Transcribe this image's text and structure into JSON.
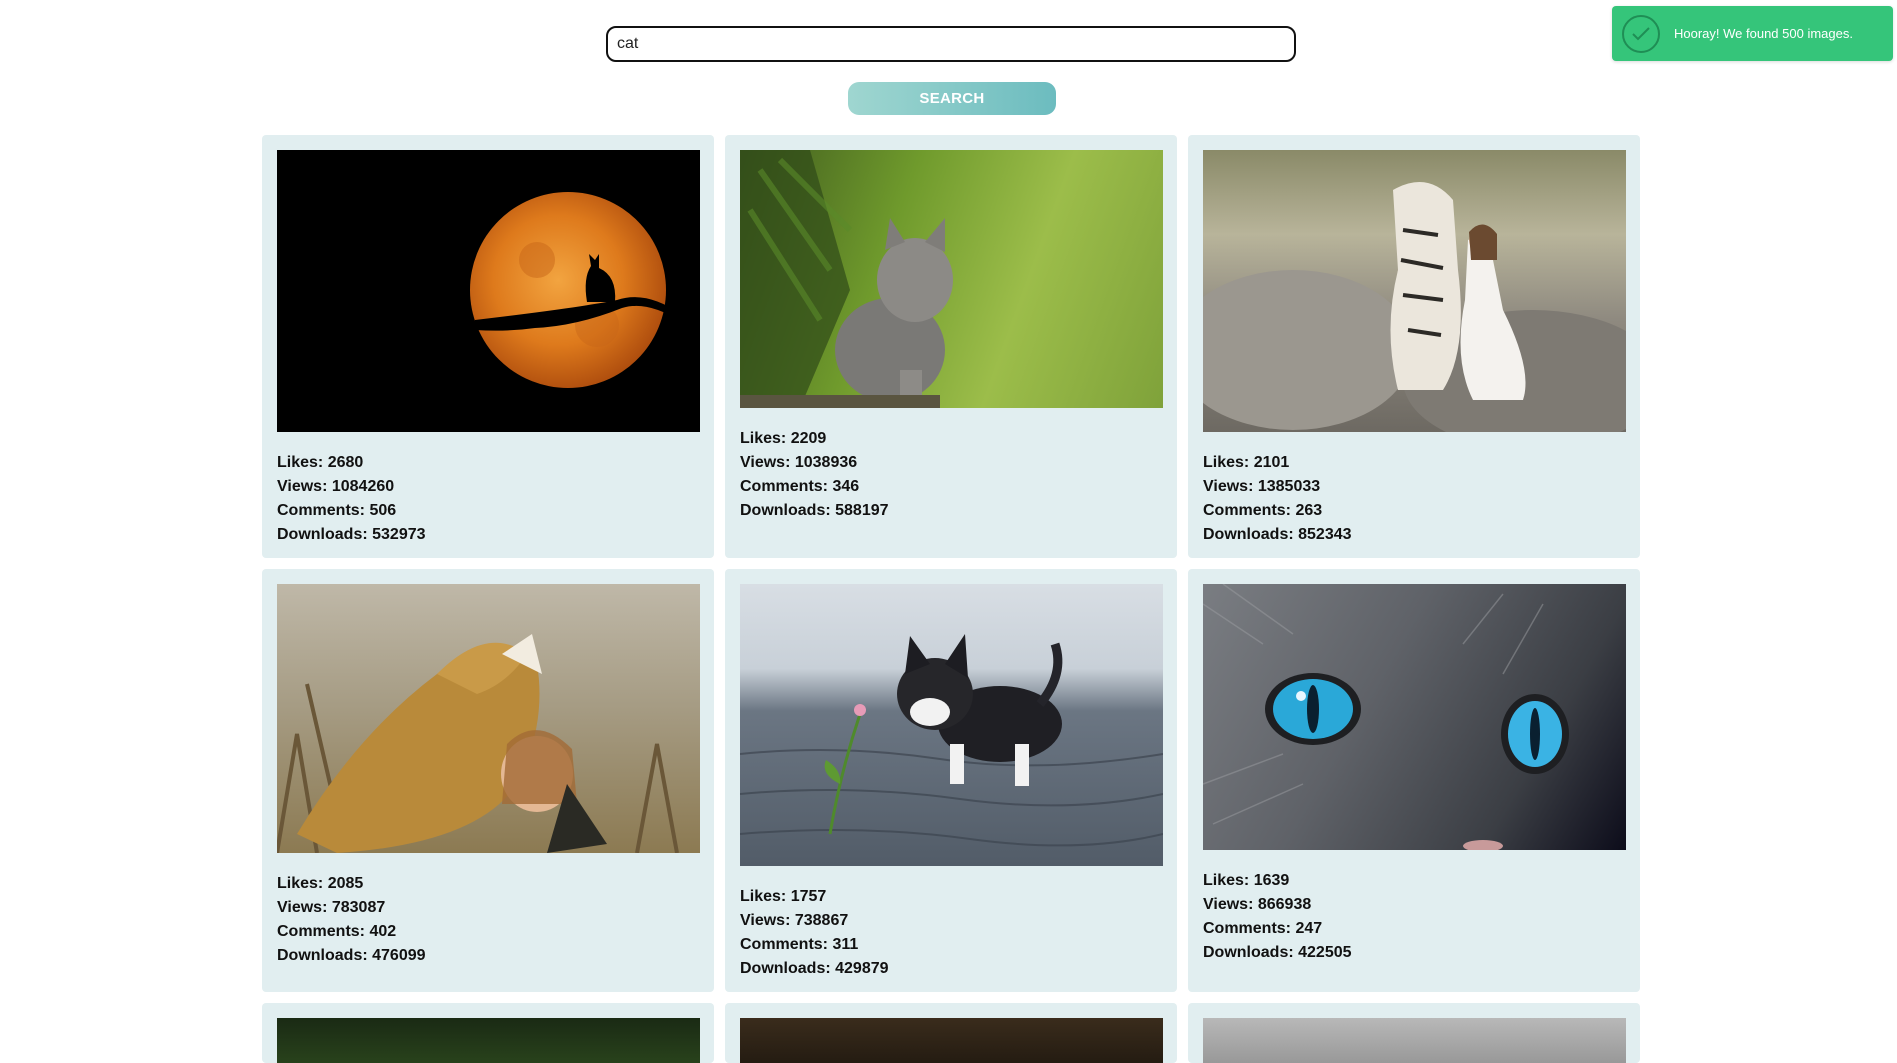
{
  "search": {
    "value": "cat",
    "button_label": "SEARCH"
  },
  "toast": {
    "message": "Hooray! We found 500 images.",
    "icon": "checkmark-icon",
    "color": "#35c57a"
  },
  "labels": {
    "likes": "Likes:",
    "views": "Views:",
    "comments": "Comments:",
    "downloads": "Downloads:"
  },
  "images": [
    {
      "subject": "cat silhouette on branch in front of orange moon",
      "likes": 2680,
      "views": 1084260,
      "comments": 506,
      "downloads": 532973
    },
    {
      "subject": "grey kitten sitting in green forest",
      "likes": 2209,
      "views": 1038936,
      "comments": 346,
      "downloads": 588197
    },
    {
      "subject": "white tiger beside woman in white dress on rocks",
      "likes": 2101,
      "views": 1385033,
      "comments": 263,
      "downloads": 852343
    },
    {
      "subject": "lioness roaring while child hugs it",
      "likes": 2085,
      "views": 783087,
      "comments": 402,
      "downloads": 476099
    },
    {
      "subject": "black and white kitten touching flower on cobblestones",
      "likes": 1757,
      "views": 738867,
      "comments": 311,
      "downloads": 429879
    },
    {
      "subject": "close-up of cat with blue eyes",
      "likes": 1639,
      "views": 866938,
      "comments": 247,
      "downloads": 422505
    },
    {
      "subject": "partially visible image",
      "likes": null,
      "views": null,
      "comments": null,
      "downloads": null
    },
    {
      "subject": "partially visible image",
      "likes": null,
      "views": null,
      "comments": null,
      "downloads": null
    },
    {
      "subject": "partially visible image",
      "likes": null,
      "views": null,
      "comments": null,
      "downloads": null
    }
  ]
}
